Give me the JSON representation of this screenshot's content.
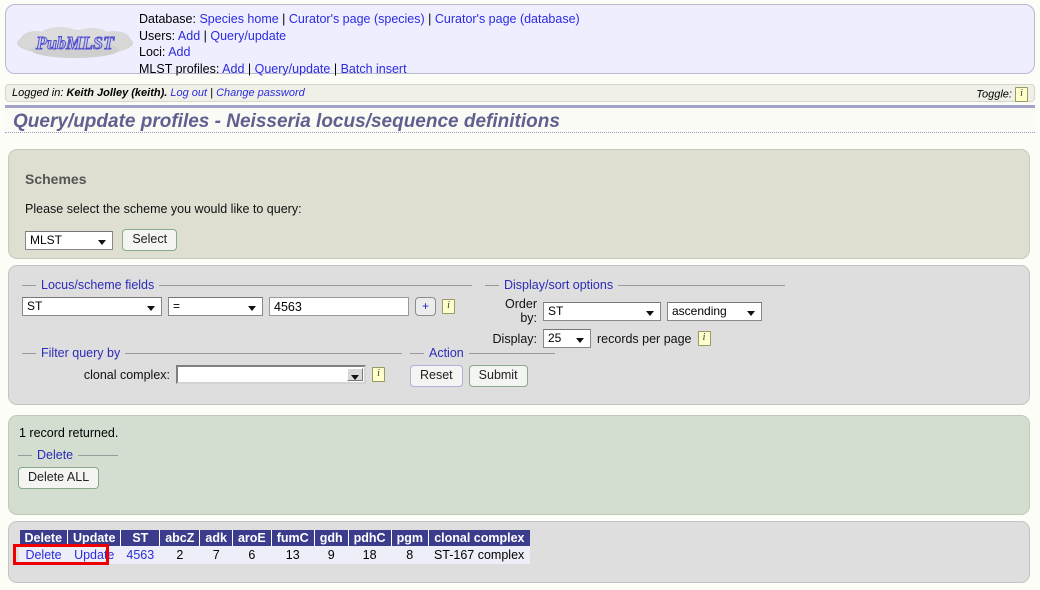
{
  "header": {
    "logo_text": "PubMLST",
    "rows": [
      {
        "label": "Database:",
        "links": [
          "Species home",
          "Curator's page (species)",
          "Curator's page (database)"
        ]
      },
      {
        "label": "Users:",
        "links": [
          "Add",
          "Query/update"
        ]
      },
      {
        "label": "Loci:",
        "links": [
          "Add"
        ]
      },
      {
        "label": "MLST profiles:",
        "links": [
          "Add",
          "Query/update",
          "Batch insert"
        ]
      }
    ]
  },
  "loginbar": {
    "prefix": "Logged in:",
    "user": "Keith Jolley (keith).",
    "logout": "Log out",
    "separator": "|",
    "change_password": "Change password",
    "toggle_label": "Toggle:",
    "toggle_icon": "i"
  },
  "page_title": "Query/update profiles - Neisseria locus/sequence definitions",
  "schemes": {
    "heading": "Schemes",
    "instruction": "Please select the scheme you would like to query:",
    "selected_scheme": "MLST",
    "scheme_options": [
      "MLST"
    ],
    "select_button": "Select"
  },
  "query": {
    "locus_legend": "Locus/scheme fields",
    "field_value": "ST",
    "operator_value": "=",
    "search_value": "4563",
    "add_button": "+",
    "info_icon": "i",
    "display_legend": "Display/sort options",
    "order_by_label": "Order by:",
    "order_by_value": "ST",
    "order_dir_value": "ascending",
    "display_label": "Display:",
    "display_value": "25",
    "records_per_page": "records per page",
    "display_info_icon": "i",
    "filter_legend": "Filter query by",
    "clonal_complex_label": "clonal complex:",
    "clonal_complex_value": "",
    "filter_info_icon": "i",
    "action_legend": "Action",
    "reset_button": "Reset",
    "submit_button": "Submit"
  },
  "results": {
    "record_count": "1 record returned.",
    "delete_legend": "Delete",
    "delete_all_button": "Delete ALL"
  },
  "table": {
    "columns": [
      "Delete",
      "Update",
      "ST",
      "abcZ",
      "adk",
      "aroE",
      "fumC",
      "gdh",
      "pdhC",
      "pgm",
      "clonal complex"
    ],
    "rows": [
      {
        "delete": "Delete",
        "update": "Update",
        "ST": "4563",
        "abcZ": "2",
        "adk": "7",
        "aroE": "6",
        "fumC": "13",
        "gdh": "9",
        "pdhC": "18",
        "pgm": "8",
        "clonal_complex": "ST-167 complex"
      }
    ]
  },
  "colors": {
    "header_bg": "#eeeeff",
    "link": "#2c2cdd",
    "title": "#606090",
    "schemes_bg": "#dedfd0",
    "panel_bg": "#dedede",
    "results_bg": "#d3ded0",
    "table_header_bg": "#3c3c8c",
    "highlight": "#ee0000"
  }
}
